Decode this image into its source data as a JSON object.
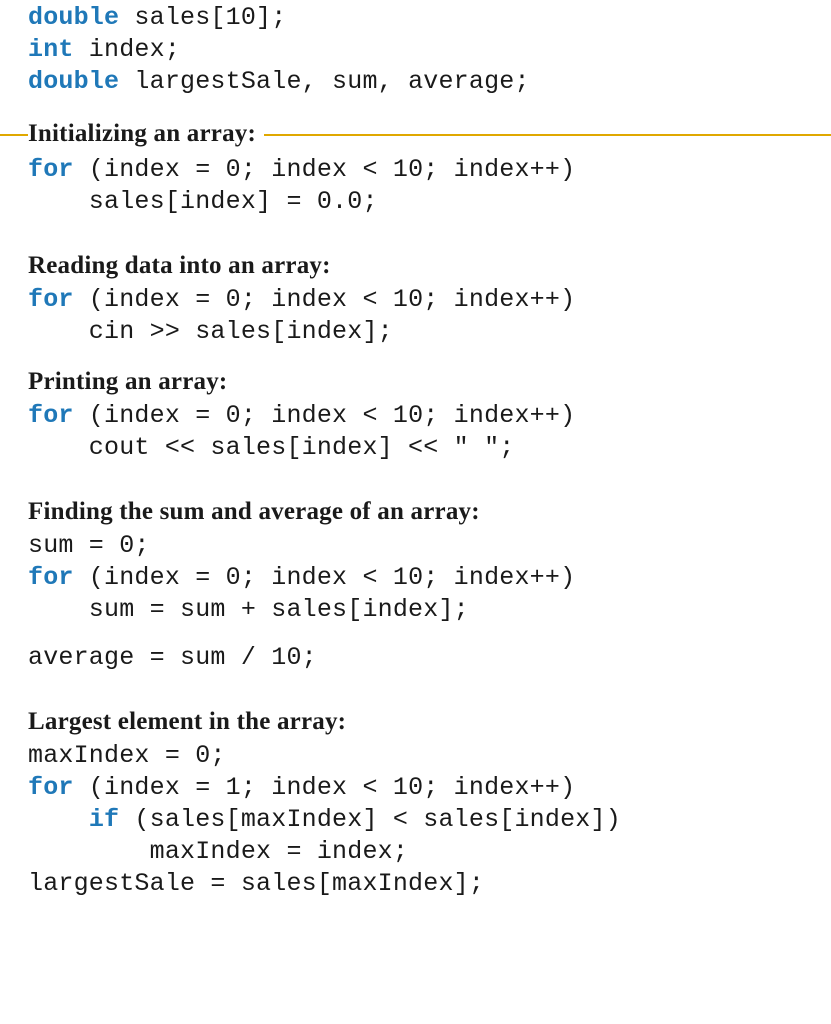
{
  "decl": {
    "l1a": "double",
    "l1b": " sales[10];",
    "l2a": "int",
    "l2b": " index;",
    "l3a": "double",
    "l3b": " largestSale, sum, average;"
  },
  "sec1": {
    "title": "Initializing an array:",
    "l1a": "for",
    "l1b": " (index = 0; index < 10; index++)",
    "l2": "    sales[index] = 0.0;"
  },
  "sec2": {
    "title": "Reading data into an array:",
    "l1a": "for",
    "l1b": " (index = 0; index < 10; index++)",
    "l2": "    cin >> sales[index];"
  },
  "sec3": {
    "title": "Printing an array:",
    "l1a": "for",
    "l1b": " (index = 0; index < 10; index++)",
    "l2": "    cout << sales[index] << \" \";"
  },
  "sec4": {
    "title": "Finding the sum and average of an array:",
    "l1": "sum = 0;",
    "l2a": "for",
    "l2b": " (index = 0; index < 10; index++)",
    "l3": "    sum = sum + sales[index];",
    "l4": "average = sum / 10;"
  },
  "sec5": {
    "title": "Largest element in the array:",
    "l1": "maxIndex = 0;",
    "l2a": "for",
    "l2b": " (index = 1; index < 10; index++)",
    "l3a": "    ",
    "l3b": "if",
    "l3c": " (sales[maxIndex] < sales[index])",
    "l4": "        maxIndex = index;",
    "l5": "largestSale = sales[maxIndex];"
  }
}
